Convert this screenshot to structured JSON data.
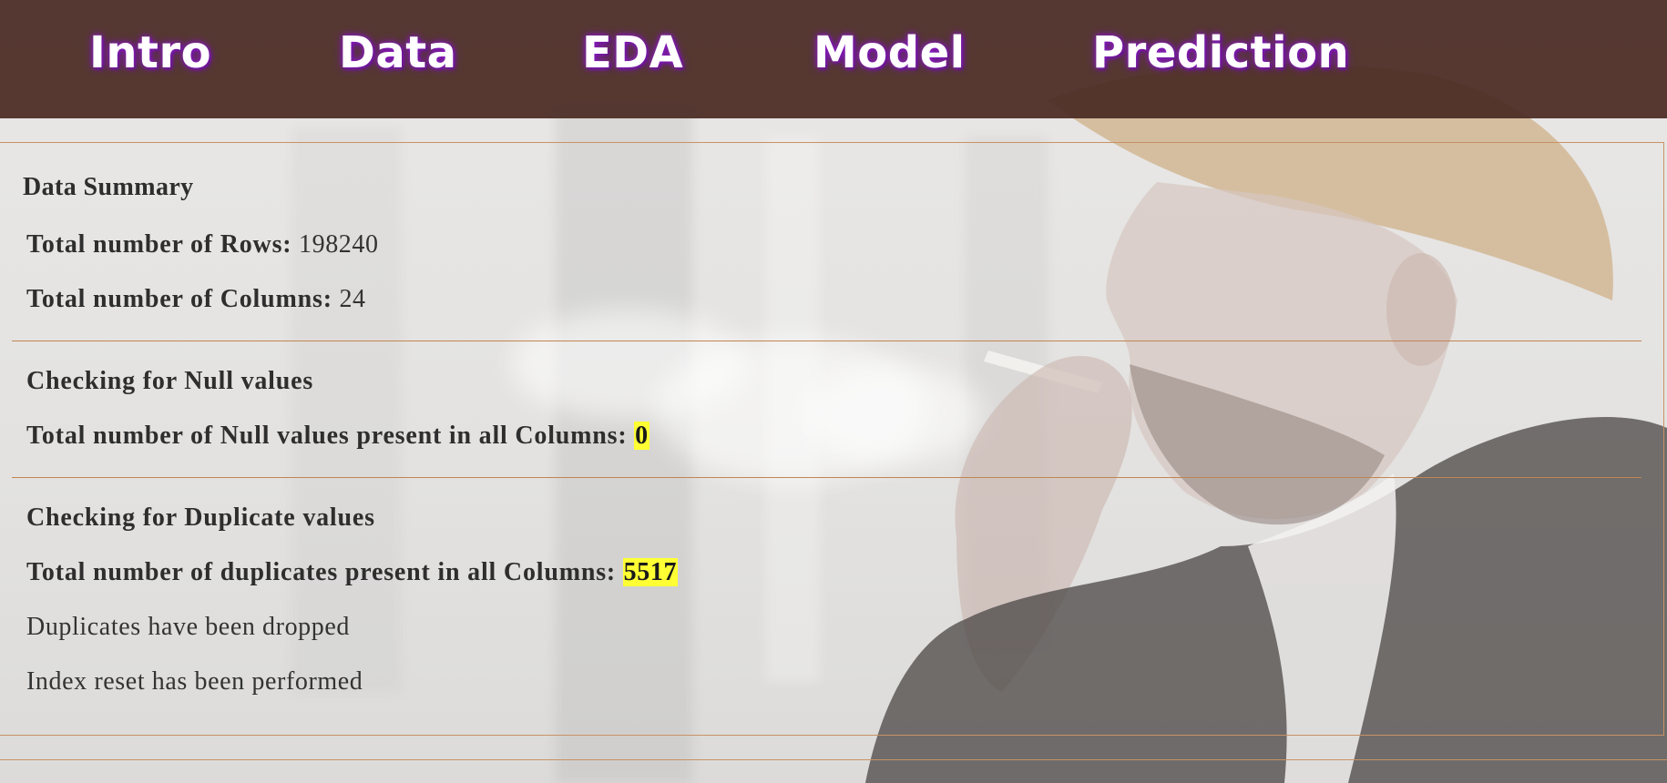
{
  "nav": {
    "items": [
      {
        "label": "Intro"
      },
      {
        "label": "Data"
      },
      {
        "label": "EDA"
      },
      {
        "label": "Model"
      },
      {
        "label": "Prediction"
      }
    ]
  },
  "summary": {
    "title": "Data Summary",
    "rows_label": "Total number of Rows:",
    "rows_value": "198240",
    "cols_label": "Total number of Columns:",
    "cols_value": "24"
  },
  "nulls": {
    "heading": "Checking for Null values",
    "label": "Total number of Null values present in all Columns:",
    "value": "0"
  },
  "duplicates": {
    "heading": "Checking for Duplicate values",
    "label": "Total number of duplicates present in all Columns:",
    "value": "5517",
    "dropped_msg": "Duplicates have been dropped",
    "reset_msg": "Index reset has been performed"
  },
  "colors": {
    "nav_bg": "#4a2a24",
    "nav_glow": "#8d1fc0",
    "divider": "#c08553",
    "highlight": "#ffff33"
  }
}
